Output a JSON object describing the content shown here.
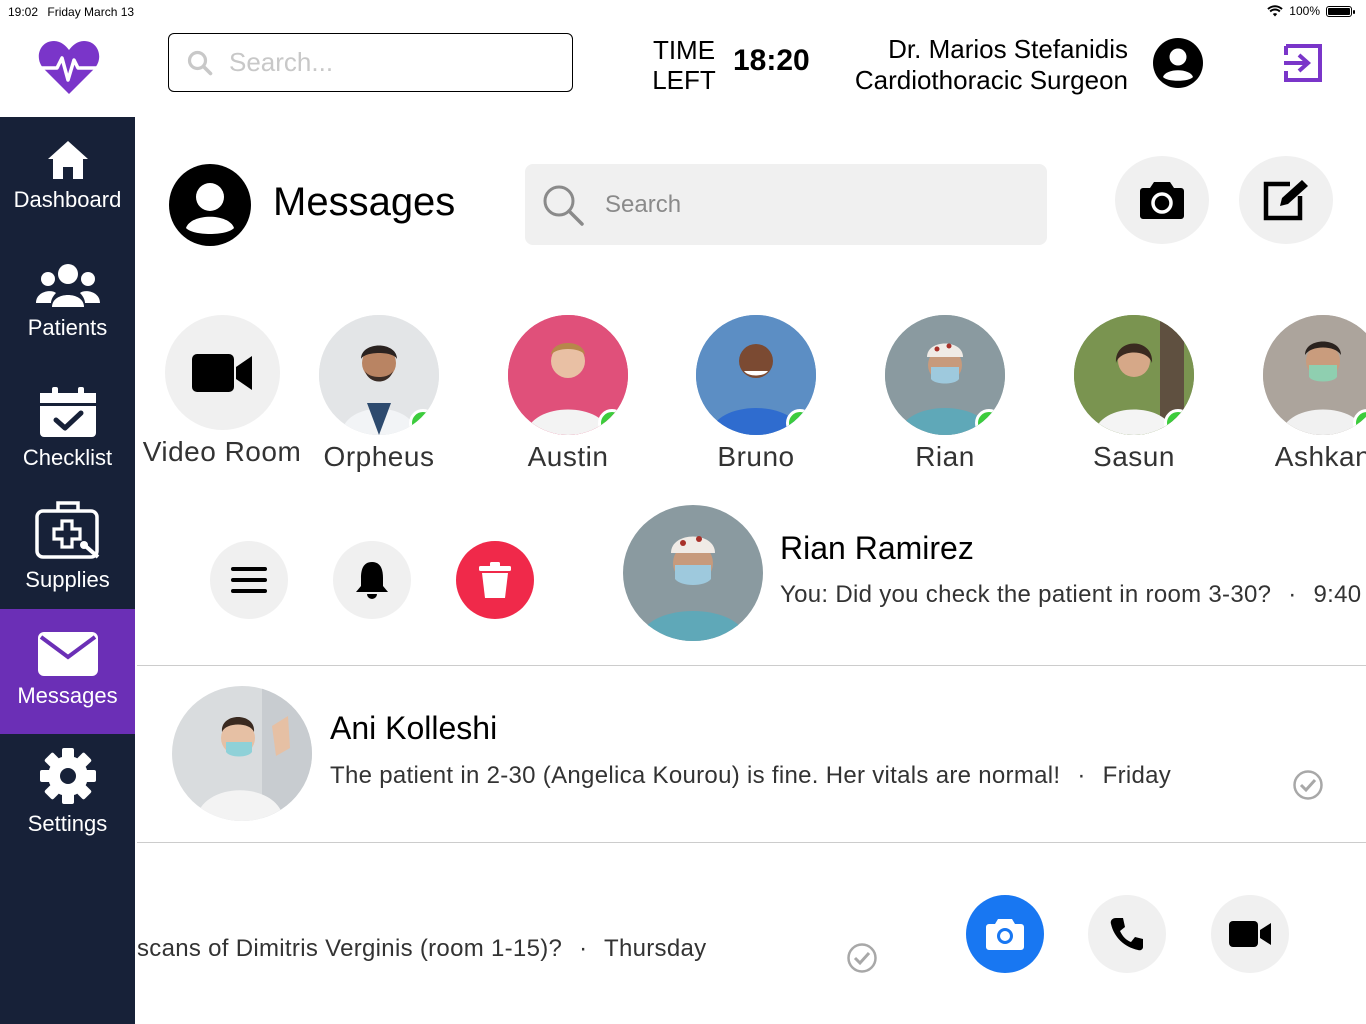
{
  "status_bar": {
    "time": "19:02",
    "date": "Friday March 13",
    "battery": "100%"
  },
  "header": {
    "search_placeholder": "Search...",
    "time_left_label_line1": "TIME",
    "time_left_label_line2": "LEFT",
    "time_left_value": "18:20",
    "doctor_name": "Dr. Marios Stefanidis",
    "doctor_role": "Cardiothoracic Surgeon"
  },
  "sidebar": {
    "items": [
      {
        "label": "Dashboard",
        "icon": "home-icon"
      },
      {
        "label": "Patients",
        "icon": "users-icon"
      },
      {
        "label": "Checklist",
        "icon": "calendar-check-icon"
      },
      {
        "label": "Supplies",
        "icon": "medical-bag-icon"
      },
      {
        "label": "Messages",
        "icon": "envelope-icon",
        "active": true
      },
      {
        "label": "Settings",
        "icon": "gear-icon"
      }
    ]
  },
  "messages": {
    "title": "Messages",
    "search_placeholder": "Search"
  },
  "contacts": [
    {
      "name": "Video Room",
      "icon": "video-camera-icon"
    },
    {
      "name": "Orpheus",
      "online": true
    },
    {
      "name": "Austin",
      "online": true
    },
    {
      "name": "Bruno",
      "online": true
    },
    {
      "name": "Rian",
      "online": true
    },
    {
      "name": "Sasun",
      "online": true
    },
    {
      "name": "Ashkan",
      "online": true
    }
  ],
  "conversations": [
    {
      "name": "Rian Ramirez",
      "preview": "You: Did you check the patient in room 3-30?",
      "separator": "·",
      "time": "9:40"
    },
    {
      "name": "Ani Kolleshi",
      "preview": "The patient in 2-30 (Angelica Kourou) is fine. Her vitals are normal!",
      "separator": "·",
      "time": "Friday"
    },
    {
      "preview": "scans of Dimitris Verginis (room 1-15)?",
      "separator": "·",
      "time": "Thursday"
    }
  ],
  "colors": {
    "sidebar": "#172138",
    "active": "#6b2fb6",
    "accent_purple": "#7a35c9",
    "online": "#3ccc3c",
    "delete": "#f0294a",
    "camera_blue": "#1877f2"
  }
}
